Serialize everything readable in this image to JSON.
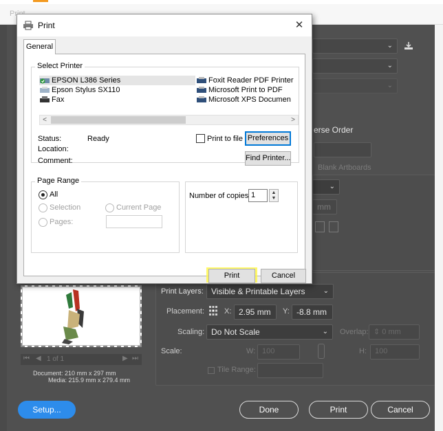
{
  "window": {
    "title": "Print"
  },
  "background": {
    "reverse_order_label": "erse Order",
    "blank_artboards_label": "Blank Artboards",
    "mm_value": "mm",
    "print_layers_label": "Print Layers:",
    "print_layers_value": "Visible & Printable Layers",
    "placement_label": "Placement:",
    "x_label": "X:",
    "x_value": "2.95 mm",
    "y_label": "Y:",
    "y_value": "-8.8 mm",
    "scaling_label": "Scaling:",
    "scaling_value": "Do Not Scale",
    "overlap_label": "Overlap:",
    "overlap_value": "0 mm",
    "scale_label": "Scale:",
    "w_label": "W:",
    "w_value": "100",
    "h_label": "H:",
    "h_value": "100",
    "tile_range_label": "Tile Range:",
    "page_nav": "1 of 1",
    "document_info": "Document: 210 mm x 297 mm",
    "media_info": "Media: 215.9 mm x 279.4 mm",
    "setup_button": "Setup...",
    "done_button": "Done",
    "print_button": "Print",
    "cancel_button": "Cancel"
  },
  "dialog": {
    "title": "Print",
    "close_glyph": "✕",
    "tab_general": "General",
    "select_printer_label": "Select Printer",
    "printers_left": [
      "EPSON L386 Series",
      "Epson Stylus SX110",
      "Fax"
    ],
    "printers_right": [
      "Foxit Reader PDF Printer",
      "Microsoft Print to PDF",
      "Microsoft XPS Documen"
    ],
    "scroll_left": "<",
    "scroll_right": ">",
    "status_label": "Status:",
    "status_value": "Ready",
    "location_label": "Location:",
    "comment_label": "Comment:",
    "print_to_file_label": "Print to file",
    "preferences_button": "Preferences",
    "find_printer_button": "Find Printer...",
    "page_range_label": "Page Range",
    "range_all": "All",
    "range_selection": "Selection",
    "range_current_page": "Current Page",
    "range_pages": "Pages:",
    "copies_label": "Number of copies:",
    "copies_value": "1",
    "print_button": "Print",
    "cancel_button": "Cancel"
  },
  "colors": {
    "highlight": "#fff645",
    "accent_blue": "#2d8ceb",
    "focus_blue": "#0078d7",
    "orange_accent": "#f39a21"
  }
}
